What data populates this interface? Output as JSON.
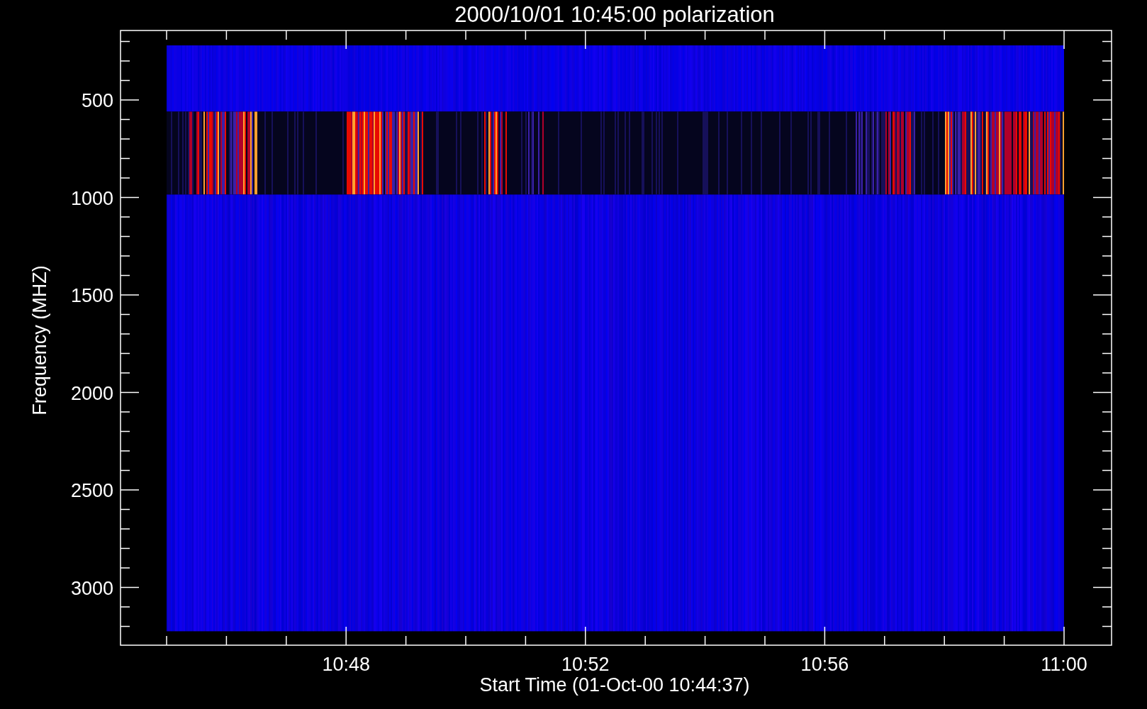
{
  "plot": {
    "title": "2000/10/01 10:45:00 polarization",
    "ylabel": "Frequency (MHZ)",
    "xlabel": "Start Time (01-Oct-00 10:44:37)",
    "ytick_labels": [
      "500",
      "1000",
      "1500",
      "2000",
      "2500",
      "3000"
    ],
    "xtick_labels": [
      "10:48",
      "10:52",
      "10:56",
      "11:00"
    ]
  }
}
